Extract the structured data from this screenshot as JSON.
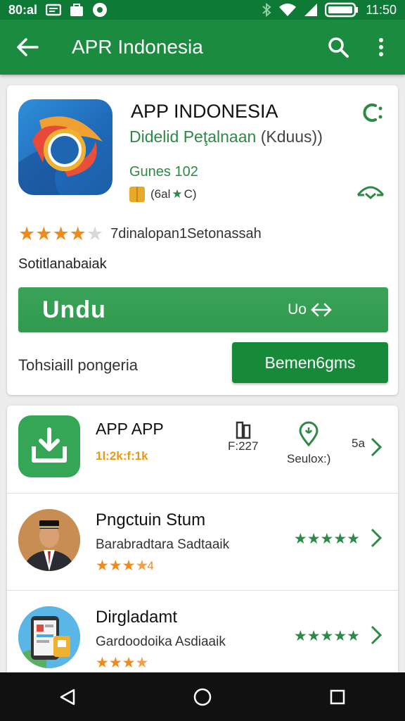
{
  "status_bar": {
    "left_text": "80:al",
    "time": "11:50"
  },
  "app_bar": {
    "title": "APR Indonesia"
  },
  "app_detail": {
    "name": "APP INDONESIA",
    "developer": "Didelid Peţalnaan",
    "developer_paren": "(Kduus))",
    "genre": "Gunes 102",
    "rating_badge": "(6al",
    "rating_badge_suffix": "C)",
    "stars_filled": 4,
    "stars_total": 5,
    "review_text": "7dinalopan1Setonassah",
    "description": "Sotitlanabaiak",
    "install_label": "Undu",
    "install_right": "Uo",
    "detail_text": "Tohsiaill pongeria",
    "secondary_button": "Bemen6gms"
  },
  "list": {
    "items": [
      {
        "title": "APP APP",
        "subtitle": "1l:2k:f:1k",
        "stat1_value": "F:227",
        "stat2_label": "Seulox:)",
        "stat3_value": "5a"
      },
      {
        "title": "Pngctuin Stum",
        "description": "Barabradtara Sadtaaik",
        "stars_filled": 3,
        "stars_partial": "4",
        "green_stars": 5
      },
      {
        "title": "Dirgladamt",
        "description": "Gardoodoika Asdiaaik",
        "stars_filled": 3,
        "green_stars": 5
      }
    ]
  },
  "colors": {
    "status_bar": "#0d7a36",
    "app_bar": "#1b8c3f",
    "install": "#35a054",
    "secondary": "#178a3a",
    "star_orange": "#f08a1c",
    "green_text": "#2d8a46"
  }
}
